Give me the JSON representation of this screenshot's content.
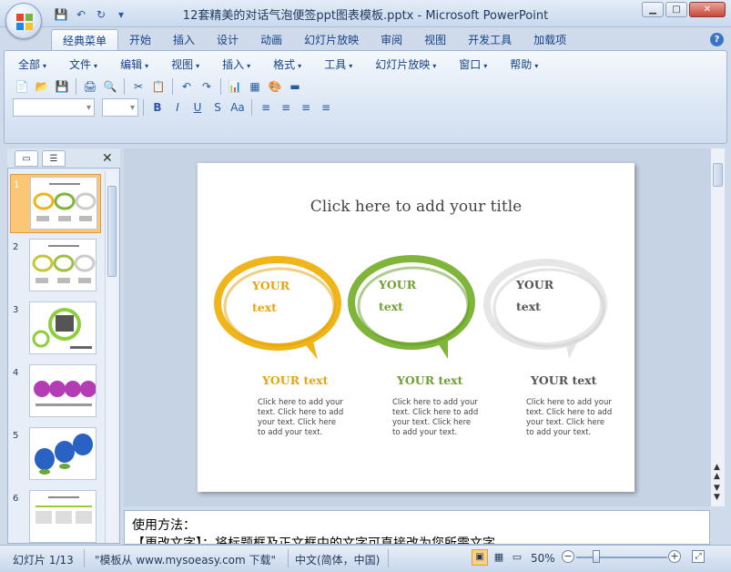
{
  "window": {
    "title": "12套精美的对话气泡便签ppt图表模板.pptx - Microsoft PowerPoint",
    "minimize": "▁",
    "maximize": "□",
    "close": "✕"
  },
  "qat": {
    "save": "💾",
    "undo": "↶",
    "redo": "↻",
    "customize": "▾"
  },
  "tabs": [
    "经典菜单",
    "开始",
    "插入",
    "设计",
    "动画",
    "幻灯片放映",
    "审阅",
    "视图",
    "开发工具",
    "加载项"
  ],
  "help": "?",
  "menu": [
    "全部",
    "文件",
    "编辑",
    "视图",
    "插入",
    "格式",
    "工具",
    "幻灯片放映",
    "窗口",
    "帮助"
  ],
  "toolbar1": [
    "📄",
    "📂",
    "💾",
    "🖨",
    "🔍",
    "✂",
    "📋",
    "↶",
    "↷",
    "📊",
    "▦",
    "🎨",
    "▬"
  ],
  "toolbar2": [
    "B",
    "I",
    "U",
    "S",
    "Aa",
    "≡",
    "≡",
    "≡",
    "≡"
  ],
  "left_panel": {
    "slides_tab": "▭",
    "outline_tab": "☰",
    "close": "✕",
    "slide_numbers": [
      "1",
      "2",
      "3",
      "4",
      "5",
      "6"
    ]
  },
  "slide": {
    "title": "Click here to add your title",
    "bubbles": [
      {
        "line1": "YOUR",
        "line2": "text",
        "heading": "YOUR text",
        "body": "Click here to add your text. Click here to add your text. Click here to add your text.",
        "color": "#f0b51a"
      },
      {
        "line1": "YOUR",
        "line2": "text",
        "heading": "YOUR text",
        "body": "Click here to add your text. Click here to add your text. Click here to add your text.",
        "color": "#7fb53a"
      },
      {
        "line1": "YOUR",
        "line2": "text",
        "heading": "YOUR text",
        "body": "Click here to add your text. Click here to add your text. Click here to add your text.",
        "color": "#dddddd"
      }
    ]
  },
  "notes": {
    "line1": "使用方法：",
    "line2": "【更改文字】：将标题框及正文框中的文字可直接改为您所需文字"
  },
  "status": {
    "slide": "幻灯片 1/13",
    "template": "\"模板从 www.mysoeasy.com 下载\"",
    "lang": "中文(简体，中国)",
    "zoom": "50%"
  },
  "colors": {
    "accent": "#15428b",
    "selected": "#fbc777"
  }
}
